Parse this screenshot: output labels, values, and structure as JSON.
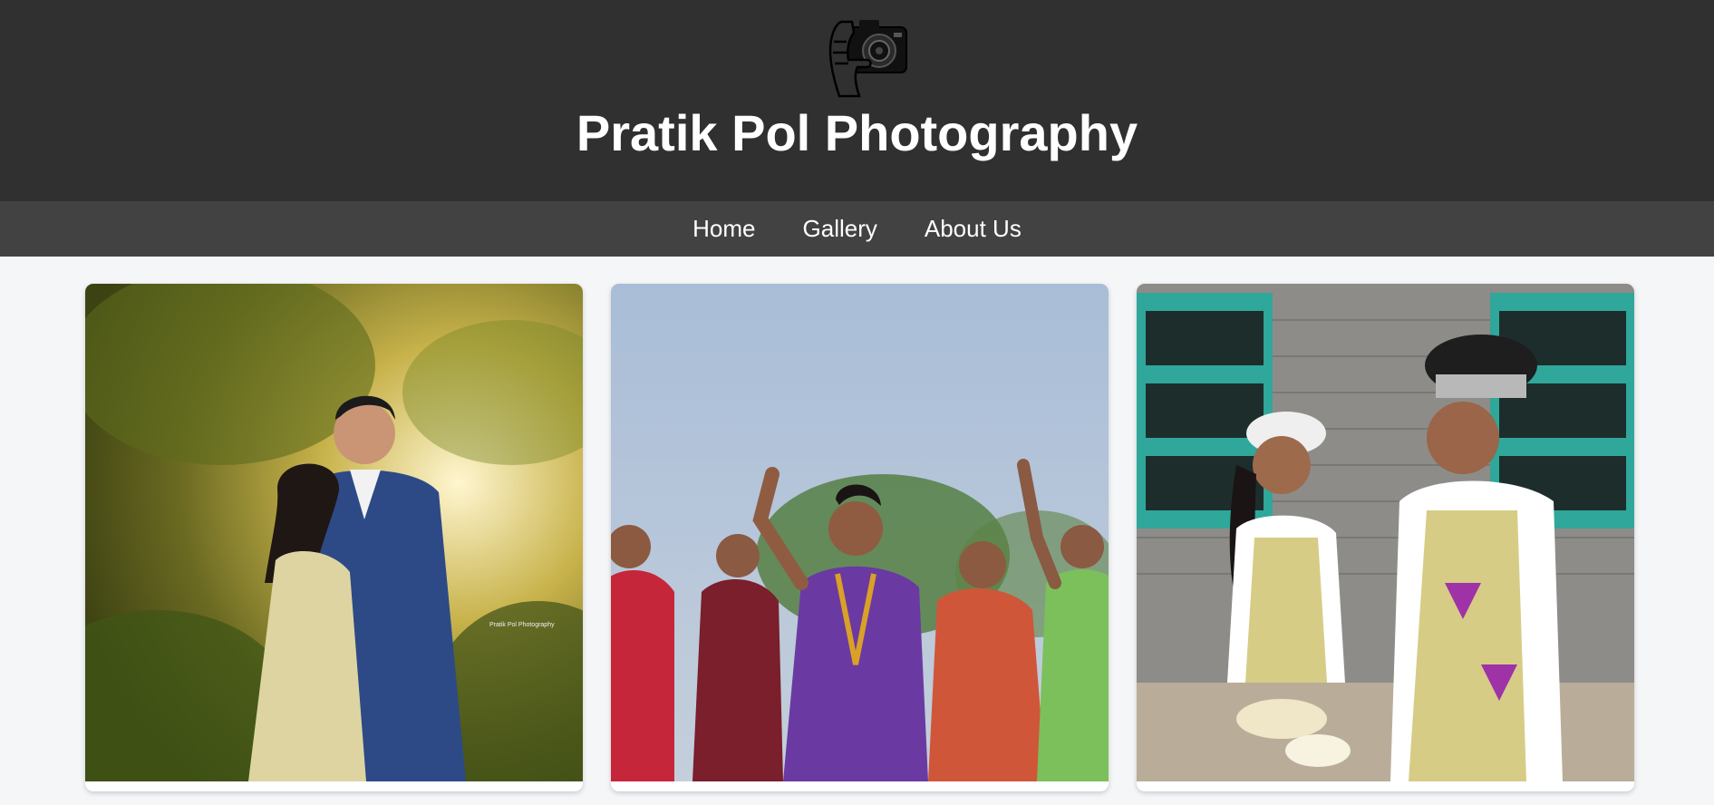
{
  "header": {
    "logo_icon": "camera-in-hand-icon",
    "title": "Pratik Pol Photography"
  },
  "nav": {
    "items": [
      {
        "label": "Home"
      },
      {
        "label": "Gallery"
      },
      {
        "label": "About Us"
      }
    ]
  },
  "gallery": {
    "photos": [
      {
        "subject": "couple-portrait-photo",
        "watermark": "Pratik Pol Photography"
      },
      {
        "subject": "celebration-group-photo"
      },
      {
        "subject": "kitchen-couple-photo"
      }
    ]
  },
  "colors": {
    "header_bg": "#303030",
    "nav_bg": "#424242",
    "page_bg": "#f5f6f8",
    "text": "#ffffff"
  }
}
